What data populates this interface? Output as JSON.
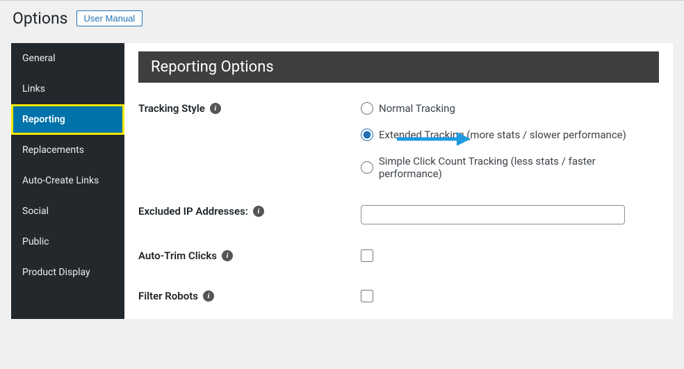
{
  "header": {
    "title": "Options",
    "user_manual_label": "User Manual"
  },
  "sidebar": {
    "items": [
      {
        "label": "General"
      },
      {
        "label": "Links"
      },
      {
        "label": "Reporting"
      },
      {
        "label": "Replacements"
      },
      {
        "label": "Auto-Create Links"
      },
      {
        "label": "Social"
      },
      {
        "label": "Public"
      },
      {
        "label": "Product Display"
      }
    ],
    "active_index": 2
  },
  "panel": {
    "title": "Reporting Options",
    "tracking_style": {
      "label": "Tracking Style",
      "options": [
        "Normal Tracking",
        "Extended Tracking (more stats / slower performance)",
        "Simple Click Count Tracking (less stats / faster performance)"
      ],
      "selected_index": 1
    },
    "excluded_ips": {
      "label": "Excluded IP Addresses:",
      "value": ""
    },
    "auto_trim": {
      "label": "Auto-Trim Clicks",
      "checked": false
    },
    "filter_robots": {
      "label": "Filter Robots",
      "checked": false
    }
  }
}
